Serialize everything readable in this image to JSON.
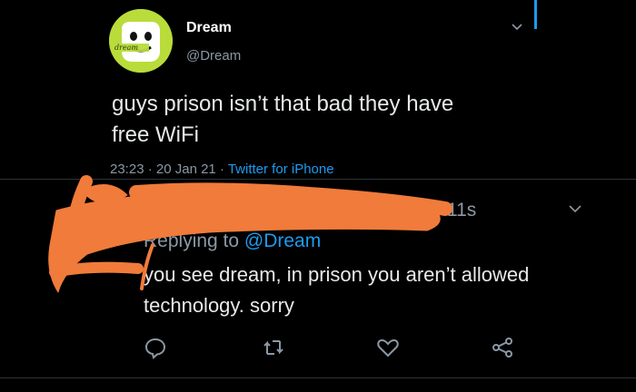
{
  "tweet": {
    "author_name": "Dream",
    "author_handle": "@Dream",
    "avatar_label": "dream",
    "text_line1": "guys prison isn’t that bad they have",
    "text_line2": "free WiFi",
    "time": "23:23",
    "date": "20 Jan 21",
    "source": "Twitter for iPhone",
    "separator": " · "
  },
  "reply": {
    "time_partial": "11s",
    "replying_prefix": "Replying to ",
    "replying_mention": "@Dream",
    "text_line1": "you see dream, in prison you aren’t allowed",
    "text_line2": "technology. sorry"
  },
  "icons": {
    "reply": "reply-icon",
    "retweet": "retweet-icon",
    "like": "heart-icon",
    "share": "share-icon",
    "menu": "chevron-down-icon"
  },
  "colors": {
    "background": "#000000",
    "accent": "#1d9bf0",
    "muted": "#8b98a5",
    "scribble": "#f07b3a",
    "avatar": "#b9dc3a"
  }
}
